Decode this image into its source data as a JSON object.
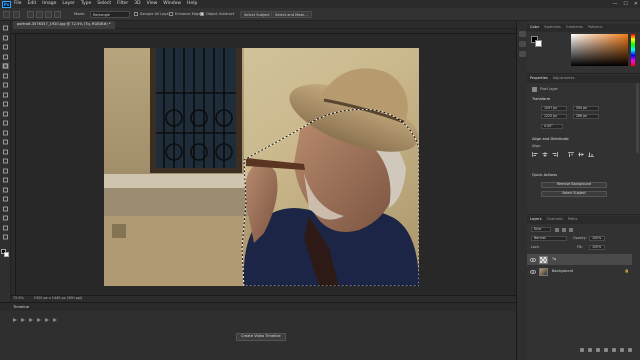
{
  "app": {
    "logo": "Ps",
    "menus": [
      "File",
      "Edit",
      "Image",
      "Layer",
      "Type",
      "Select",
      "Filter",
      "3D",
      "View",
      "Window",
      "Help"
    ],
    "window_controls": [
      "—",
      "☐",
      "✕"
    ]
  },
  "options_bar": {
    "mode_label": "Mode:",
    "mode_value": "Rectangle",
    "sample_all_layers": "Sample All Layers",
    "enhance_edge": "Enhance Edge",
    "object_subtract": "Object Subtract",
    "select_subject": "Select Subject",
    "select_and_mask": "Select and Mask..."
  },
  "document": {
    "tab_title": "portrait-3576357_1920.jpg @ 72.5% (Tq, RGB/8#) *",
    "status_zoom": "72.5%",
    "status_info": "1920 px x 1440 px (300 ppi)"
  },
  "timeline": {
    "title": "Timeline",
    "create_button": "Create Video Timeline"
  },
  "color_panel": {
    "tabs": [
      "Color",
      "Swatches",
      "Gradients",
      "Patterns"
    ],
    "accent": "#f07d1a"
  },
  "properties_panel": {
    "tabs": [
      "Properties",
      "Adjustments"
    ],
    "layer_kind": "Pixel Layer",
    "transform_title": "Transform",
    "w": "1097 px",
    "x": "594 px",
    "h": "1225 px",
    "y": "286 px",
    "angle": "0.00°",
    "align_title": "Align and Distribute",
    "align_label": "Align:",
    "quick_actions_title": "Quick Actions",
    "remove_background": "Remove Background",
    "select_subject": "Select Subject"
  },
  "layers_panel": {
    "tabs": [
      "Layers",
      "Channels",
      "Paths"
    ],
    "kind_filter": "Kind",
    "blend_mode": "Normal",
    "opacity_label": "Opacity:",
    "opacity_value": "100%",
    "lock_label": "Lock:",
    "fill_label": "Fill:",
    "fill_value": "100%",
    "layers": [
      {
        "name": "Tq",
        "selected": true
      },
      {
        "name": "Background",
        "selected": false
      }
    ]
  }
}
